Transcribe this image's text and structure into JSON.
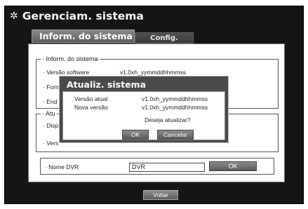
{
  "title": "Gerenciam. sistema",
  "tabs": {
    "active": "Inform. do sistema",
    "inactive": "Config."
  },
  "info_group": {
    "legend": "· Inform. do sistema",
    "rows": [
      {
        "label": "· Versão software",
        "value": "v1.0xh_yymmddhhmmss"
      },
      {
        "label": "· Forn"
      },
      {
        "label": "· End"
      }
    ]
  },
  "update_group": {
    "legend": "· Atu",
    "rows": [
      {
        "label": "· Disp"
      },
      {
        "label": "· Vers"
      }
    ]
  },
  "name_row": {
    "label": "· Nome DVR",
    "value": "DVR",
    "button": "OK"
  },
  "footer": {
    "back": "Voltar"
  },
  "dialog": {
    "title": "Atualiz. sistema",
    "current_label": "Versão atual",
    "current_value": "v1.0xh_yymmddhhmmss",
    "new_label": "Nova versão",
    "new_value": "v1.0xh_yymmddhhmmss",
    "question": "Deseja atualizar?",
    "ok": "OK",
    "cancel": "Cancelar"
  }
}
